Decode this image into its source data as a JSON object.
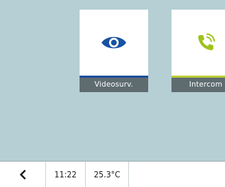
{
  "tiles": [
    {
      "id": "videosurv",
      "label": "Videosurv.",
      "icon": "eye-icon",
      "icon_color": "#1752a3",
      "accent_color": "#1a4f9c"
    },
    {
      "id": "intercom",
      "label": "Intercom",
      "icon": "phone-ringing-icon",
      "icon_color": "#9fc21e",
      "accent_color": "#b9cc33"
    }
  ],
  "statusbar": {
    "back_icon": "chevron-left-icon",
    "time": "11:22",
    "temperature": "25.3°C"
  },
  "colors": {
    "background": "#b5cfd4",
    "label_bar": "#5e6c70"
  }
}
